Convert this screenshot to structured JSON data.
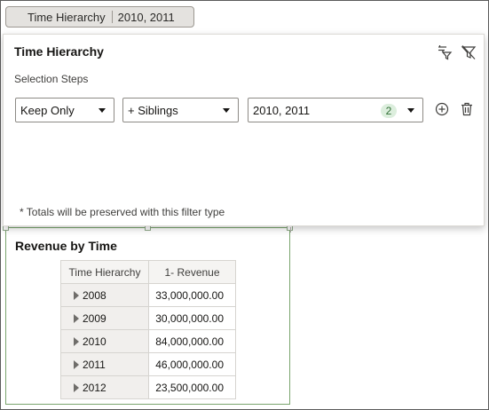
{
  "filter_chip": {
    "label": "Time Hierarchy",
    "value": "2010, 2011"
  },
  "panel": {
    "title": "Time Hierarchy",
    "subheading": "Selection Steps",
    "step": {
      "action": "Keep Only",
      "relation": "+ Siblings",
      "members": "2010, 2011",
      "member_count": "2"
    },
    "footnote": "* Totals will be preserved with this filter type",
    "icons": [
      "filter-options-icon",
      "clear-filter-icon",
      "add-step-icon",
      "delete-step-icon"
    ]
  },
  "visualization": {
    "title": "Revenue by Time",
    "columns": [
      "Time Hierarchy",
      "1- Revenue"
    ],
    "rows": [
      {
        "label": "2008",
        "value": "33,000,000.00"
      },
      {
        "label": "2009",
        "value": "30,000,000.00"
      },
      {
        "label": "2010",
        "value": "84,000,000.00"
      },
      {
        "label": "2011",
        "value": "46,000,000.00"
      },
      {
        "label": "2012",
        "value": "23,500,000.00"
      }
    ]
  },
  "colors": {
    "accent_green": "#7aa56e",
    "count_badge": "#dceedd"
  }
}
